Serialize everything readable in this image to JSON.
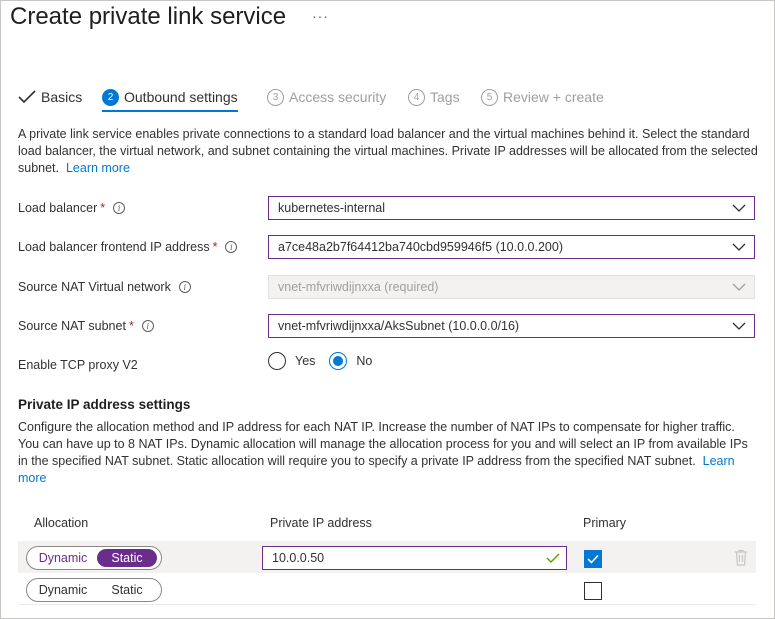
{
  "page": {
    "title": "Create private link service",
    "more": "···"
  },
  "tabs": [
    {
      "num": "",
      "label": "Basics"
    },
    {
      "num": "2",
      "label": "Outbound settings"
    },
    {
      "num": "3",
      "label": "Access security"
    },
    {
      "num": "4",
      "label": "Tags"
    },
    {
      "num": "5",
      "label": "Review + create"
    }
  ],
  "intro": {
    "text": "A private link service enables private connections to a standard load balancer and the virtual machines behind it. Select the standard load balancer, the virtual network, and subnet containing the virtual machines. Private IP addresses will be allocated from the selected subnet.",
    "link": "Learn more"
  },
  "fields": {
    "load_balancer": {
      "label": "Load balancer",
      "required": "*",
      "value": "kubernetes-internal"
    },
    "frontend_ip": {
      "label": "Load balancer frontend IP address",
      "required": "*",
      "value": "a7ce48a2b7f64412ba740cbd959946f5 (10.0.0.200)"
    },
    "source_nat_vnet": {
      "label": "Source NAT Virtual network",
      "value": "vnet-mfvriwdijnxxa (required)"
    },
    "source_nat_subnet": {
      "label": "Source NAT subnet",
      "required": "*",
      "value": "vnet-mfvriwdijnxxa/AksSubnet (10.0.0.0/16)"
    },
    "tcp_proxy": {
      "label": "Enable TCP proxy V2",
      "options": [
        "Yes",
        "No"
      ],
      "selected": "No"
    }
  },
  "private_ip": {
    "title": "Private IP address settings",
    "text": "Configure the allocation method and IP address for each NAT IP. Increase the number of NAT IPs to compensate for higher traffic. You can have up to 8 NAT IPs. Dynamic allocation will manage the allocation process for you and will select an IP from available IPs in the specified NAT subnet. Static allocation will require you to specify a private IP address from the specified NAT subnet.",
    "link": "Learn more",
    "columns": {
      "allocation": "Allocation",
      "ip": "Private IP address",
      "primary": "Primary"
    },
    "rows": [
      {
        "dynamic": "Dynamic",
        "static": "Static",
        "selected": "Static",
        "ip": "10.0.0.50",
        "primary": true
      },
      {
        "dynamic": "Dynamic",
        "static": "Static",
        "selected": "",
        "ip": "",
        "primary": false
      }
    ]
  },
  "colors": {
    "accent": "#0078d4",
    "selection": "#6b2d8c",
    "required": "#a4262c"
  }
}
